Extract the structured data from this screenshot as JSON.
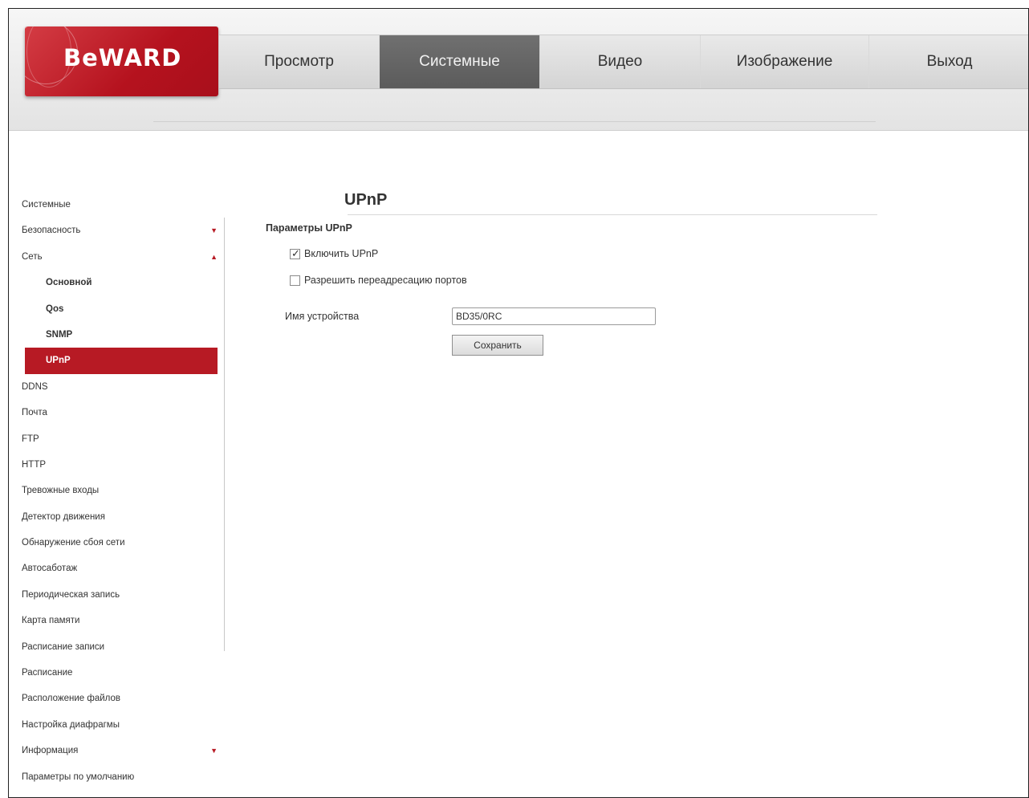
{
  "brand": {
    "logo_text": "BeWARD",
    "logo_sub": ""
  },
  "nav": {
    "tabs": [
      {
        "label": "Просмотр",
        "active": false
      },
      {
        "label": "Системные",
        "active": true
      },
      {
        "label": "Видео",
        "active": false
      },
      {
        "label": "Изображение",
        "active": false
      },
      {
        "label": "Выход",
        "active": false
      }
    ]
  },
  "sidebar": {
    "items": [
      {
        "label": "Системные",
        "sub": false,
        "active": false,
        "arrow": ""
      },
      {
        "label": "Безопасность",
        "sub": false,
        "active": false,
        "arrow": "▼"
      },
      {
        "label": "Сеть",
        "sub": false,
        "active": false,
        "arrow": "▲"
      },
      {
        "label": "Основной",
        "sub": true,
        "active": false,
        "arrow": ""
      },
      {
        "label": "Qos",
        "sub": true,
        "active": false,
        "arrow": ""
      },
      {
        "label": "SNMP",
        "sub": true,
        "active": false,
        "arrow": ""
      },
      {
        "label": "UPnP",
        "sub": true,
        "active": true,
        "arrow": ""
      },
      {
        "label": "DDNS",
        "sub": false,
        "active": false,
        "arrow": ""
      },
      {
        "label": "Почта",
        "sub": false,
        "active": false,
        "arrow": ""
      },
      {
        "label": "FTP",
        "sub": false,
        "active": false,
        "arrow": ""
      },
      {
        "label": "HTTP",
        "sub": false,
        "active": false,
        "arrow": ""
      },
      {
        "label": "Тревожные входы",
        "sub": false,
        "active": false,
        "arrow": ""
      },
      {
        "label": "Детектор движения",
        "sub": false,
        "active": false,
        "arrow": ""
      },
      {
        "label": "Обнаружение сбоя сети",
        "sub": false,
        "active": false,
        "arrow": ""
      },
      {
        "label": "Автосаботаж",
        "sub": false,
        "active": false,
        "arrow": ""
      },
      {
        "label": "Периодическая запись",
        "sub": false,
        "active": false,
        "arrow": ""
      },
      {
        "label": "Карта памяти",
        "sub": false,
        "active": false,
        "arrow": ""
      },
      {
        "label": "Расписание записи",
        "sub": false,
        "active": false,
        "arrow": ""
      },
      {
        "label": "Расписание",
        "sub": false,
        "active": false,
        "arrow": ""
      },
      {
        "label": "Расположение файлов",
        "sub": false,
        "active": false,
        "arrow": ""
      },
      {
        "label": "Настройка диафрагмы",
        "sub": false,
        "active": false,
        "arrow": ""
      },
      {
        "label": "Информация",
        "sub": false,
        "active": false,
        "arrow": "▼"
      },
      {
        "label": "Параметры по умолчанию",
        "sub": false,
        "active": false,
        "arrow": ""
      }
    ]
  },
  "main": {
    "title": "UPnP",
    "section_label": "Параметры UPnP",
    "enable_upnp": {
      "label": "Включить UPnP",
      "checked": true
    },
    "port_forwarding": {
      "label": "Разрешить переадресацию портов",
      "checked": false
    },
    "device_name": {
      "label": "Имя устройства",
      "value": "BD35/0RC"
    },
    "save_label": "Сохранить"
  },
  "colors": {
    "accent": "#b71a24",
    "nav_active": "#5f5f5f"
  }
}
